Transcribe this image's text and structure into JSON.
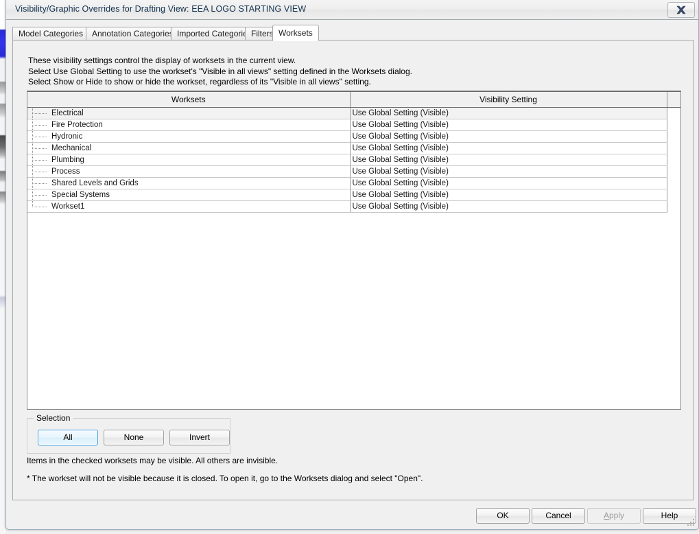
{
  "window": {
    "title": "Visibility/Graphic Overrides for Drafting View: EEA LOGO STARTING VIEW",
    "close_label": "x"
  },
  "tabs": [
    {
      "label": "Model Categories",
      "active": false
    },
    {
      "label": "Annotation Categories",
      "active": false
    },
    {
      "label": "Imported Categories",
      "active": false
    },
    {
      "label": "Filters",
      "active": false
    },
    {
      "label": "Worksets",
      "active": true
    }
  ],
  "intro": {
    "line1": "These visibility settings control the display of worksets in the current view.",
    "line2": "Select Use Global Setting to use the workset's \"Visible in all views\" setting defined in the Worksets dialog.",
    "line3": "Select Show or Hide to show or hide the workset, regardless of its \"Visible in all views\" setting."
  },
  "table": {
    "columns": [
      "Worksets",
      "Visibility Setting",
      ""
    ],
    "rows": [
      {
        "workset": "Electrical",
        "visibility": "Use Global Setting (Visible)"
      },
      {
        "workset": "Fire Protection",
        "visibility": "Use Global Setting (Visible)"
      },
      {
        "workset": "Hydronic",
        "visibility": "Use Global Setting (Visible)"
      },
      {
        "workset": "Mechanical",
        "visibility": "Use Global Setting (Visible)"
      },
      {
        "workset": "Plumbing",
        "visibility": "Use Global Setting (Visible)"
      },
      {
        "workset": "Process",
        "visibility": "Use Global Setting (Visible)"
      },
      {
        "workset": "Shared Levels and Grids",
        "visibility": "Use Global Setting (Visible)"
      },
      {
        "workset": "Special Systems",
        "visibility": "Use Global Setting (Visible)"
      },
      {
        "workset": "Workset1",
        "visibility": "Use Global Setting (Visible)"
      }
    ]
  },
  "selection": {
    "legend": "Selection",
    "all_label": "All",
    "none_label": "None",
    "invert_label": "Invert"
  },
  "notes": {
    "note1": "Items in the checked worksets may be visible.  All others are invisible.",
    "note2": "* The workset will not be visible because it is closed. To open it, go to the Worksets dialog and select \"Open\"."
  },
  "footer": {
    "ok_label": "OK",
    "cancel_label": "Cancel",
    "apply_label": "Apply",
    "apply_mnemonic": "A",
    "apply_rest": "pply",
    "help_label": "Help"
  },
  "colors": {
    "focus_blue": "#3c9ddd",
    "title_text": "#14324f",
    "panel_bg": "#f0f0f0"
  }
}
